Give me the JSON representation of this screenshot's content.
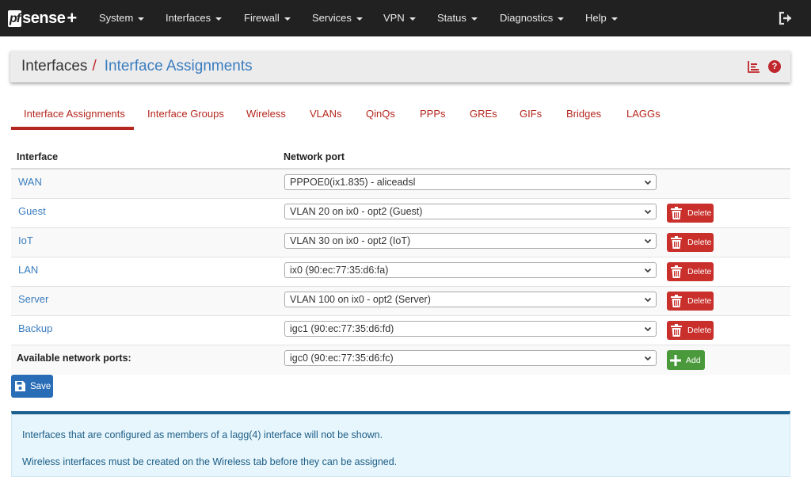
{
  "brand": {
    "pf": "pf",
    "sense": "sense",
    "plus": "+"
  },
  "nav": [
    {
      "label": "System"
    },
    {
      "label": "Interfaces"
    },
    {
      "label": "Firewall"
    },
    {
      "label": "Services"
    },
    {
      "label": "VPN"
    },
    {
      "label": "Status"
    },
    {
      "label": "Diagnostics"
    },
    {
      "label": "Help"
    }
  ],
  "header": {
    "title": "Interfaces",
    "separator": "/",
    "subtitle": "Interface Assignments",
    "help": "?"
  },
  "tabs": [
    {
      "label": "Interface Assignments",
      "active": true
    },
    {
      "label": "Interface Groups"
    },
    {
      "label": "Wireless"
    },
    {
      "label": "VLANs"
    },
    {
      "label": "QinQs"
    },
    {
      "label": "PPPs"
    },
    {
      "label": "GREs"
    },
    {
      "label": "GIFs"
    },
    {
      "label": "Bridges"
    },
    {
      "label": "LAGGs"
    }
  ],
  "table": {
    "col_interface": "Interface",
    "col_port": "Network port",
    "rows": [
      {
        "name": "WAN",
        "port": "PPPOE0(ix1.835) - aliceadsl",
        "deletable": false
      },
      {
        "name": "Guest",
        "port": "VLAN 20 on ix0 - opt2 (Guest)",
        "deletable": true
      },
      {
        "name": "IoT",
        "port": "VLAN 30 on ix0 - opt2 (IoT)",
        "deletable": true
      },
      {
        "name": "LAN",
        "port": "ix0 (90:ec:77:35:d6:fa)",
        "deletable": true
      },
      {
        "name": "Server",
        "port": "VLAN 100 on ix0 - opt2 (Server)",
        "deletable": true
      },
      {
        "name": "Backup",
        "port": "igc1 (90:ec:77:35:d6:fd)",
        "deletable": true
      }
    ],
    "available_label": "Available network ports:",
    "available_port": "igc0 (90:ec:77:35:d6:fc)",
    "delete_label": "Delete",
    "add_label": "Add"
  },
  "save_label": "Save",
  "info": {
    "line1": "Interfaces that are configured as members of a lagg(4) interface will not be shown.",
    "line2": "Wireless interfaces must be created on the Wireless tab before they can be assigned."
  },
  "colors": {
    "navbar": "#212121",
    "accent_red": "#b5271e",
    "link_blue": "#3a7dc0",
    "delete_red": "#c9302c",
    "add_green": "#4a9a3c",
    "save_blue": "#2a6db7",
    "info_bg": "#e7f6fc"
  }
}
